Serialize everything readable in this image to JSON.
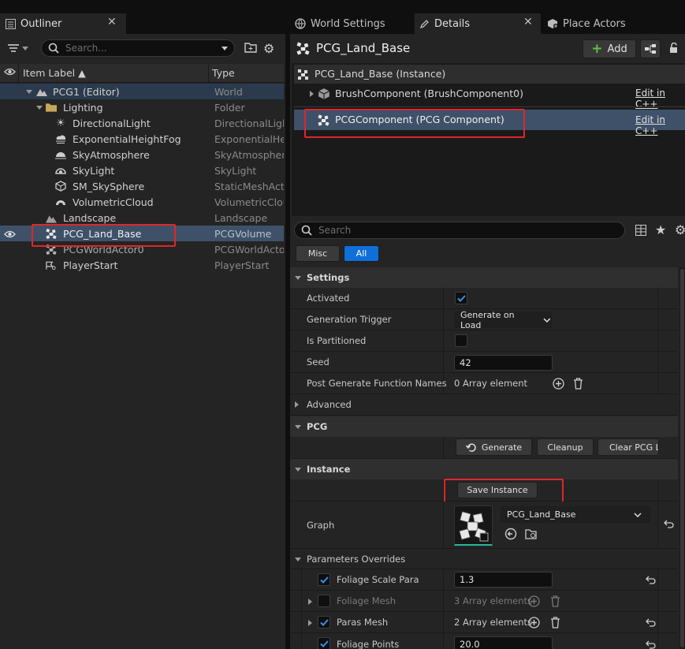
{
  "outliner": {
    "tab_label": "Outliner",
    "search_placeholder": "Search...",
    "col_label": "Item Label ▲",
    "col_type": "Type",
    "items": [
      {
        "label": "PCG1 (Editor)",
        "type": "World",
        "icon": "world-icon"
      },
      {
        "label": "Lighting",
        "type": "Folder",
        "icon": "folder-icon"
      },
      {
        "label": "DirectionalLight",
        "type": "DirectionalLight",
        "icon": "directional-light-icon"
      },
      {
        "label": "ExponentialHeightFog",
        "type": "ExponentialHeightFog",
        "icon": "fog-icon"
      },
      {
        "label": "SkyAtmosphere",
        "type": "SkyAtmosphere",
        "icon": "sky-atmosphere-icon"
      },
      {
        "label": "SkyLight",
        "type": "SkyLight",
        "icon": "sky-light-icon"
      },
      {
        "label": "SM_SkySphere",
        "type": "StaticMeshActor",
        "icon": "static-mesh-icon"
      },
      {
        "label": "VolumetricCloud",
        "type": "VolumetricCloud",
        "icon": "cloud-icon"
      },
      {
        "label": "Landscape",
        "type": "Landscape",
        "icon": "landscape-icon"
      },
      {
        "label": "PCG_Land_Base",
        "type": "PCGVolume",
        "icon": "pcg-icon"
      },
      {
        "label": "PCGWorldActor0",
        "type": "PCGWorldActor",
        "icon": "pcg-icon"
      },
      {
        "label": "PlayerStart",
        "type": "PlayerStart",
        "icon": "player-start-icon"
      }
    ]
  },
  "tabs": {
    "world_settings": "World Settings",
    "details": "Details",
    "place_actors": "Place Actors"
  },
  "details": {
    "actor_name": "PCG_Land_Base",
    "add_label": "Add",
    "instance_label": "PCG_Land_Base (Instance)",
    "components": [
      {
        "label": "BrushComponent (BrushComponent0)",
        "link": "Edit in C++"
      },
      {
        "label": "PCGComponent (PCG Component)",
        "link": "Edit in C++"
      }
    ],
    "search_placeholder": "Search",
    "filter_misc": "Misc",
    "filter_all": "All",
    "settings": {
      "header": "Settings",
      "activated": "Activated",
      "generation_trigger": "Generation Trigger",
      "generation_trigger_value": "Generate on Load",
      "is_partitioned": "Is Partitioned",
      "seed": "Seed",
      "seed_value": "42",
      "post_generate": "Post Generate Function Names",
      "post_generate_value": "0 Array element",
      "advanced": "Advanced"
    },
    "pcg": {
      "header": "PCG",
      "generate": "Generate",
      "cleanup": "Cleanup",
      "clear_pcg": "Clear PCG Li"
    },
    "instance": {
      "header": "Instance",
      "save_instance": "Save Instance",
      "graph": "Graph",
      "graph_value": "PCG_Land_Base"
    },
    "params": {
      "header": "Parameters Overrides",
      "foliage_scale": "Foliage Scale Para",
      "foliage_scale_value": "1.3",
      "foliage_mesh": "Foliage Mesh",
      "foliage_mesh_value": "3 Array elements",
      "paras_mesh": "Paras Mesh",
      "paras_mesh_value": "2 Array elements",
      "foliage_points": "Foliage Points",
      "foliage_points_value": "20.0"
    }
  },
  "colors": {
    "highlight": "#e0262a",
    "accent": "#0e6fd8",
    "selection": "#3e5168"
  }
}
